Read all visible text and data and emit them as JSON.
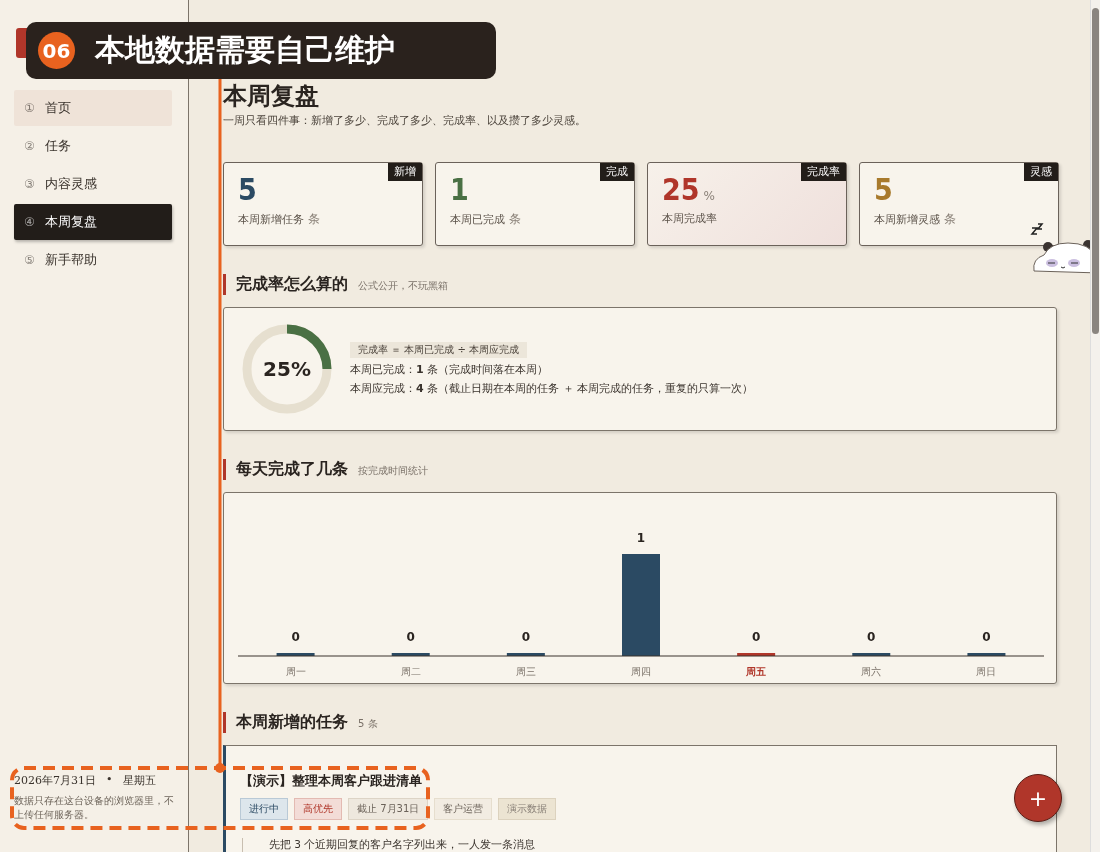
{
  "callout": {
    "badge": "06",
    "text": "本地数据需要自己维护"
  },
  "sidebar": {
    "items": [
      {
        "index": "①",
        "label": "首页",
        "selected": false,
        "hovered": true
      },
      {
        "index": "②",
        "label": "任务",
        "selected": false,
        "hovered": false
      },
      {
        "index": "③",
        "label": "内容灵感",
        "selected": false,
        "hovered": false
      },
      {
        "index": "④",
        "label": "本周复盘",
        "selected": true,
        "hovered": false
      },
      {
        "index": "⑤",
        "label": "新手帮助",
        "selected": false,
        "hovered": false
      }
    ],
    "date": "2026年7月31日",
    "separator": "•",
    "weekday": "星期五",
    "note": "数据只存在这台设备的浏览器里，不上传任何服务器。"
  },
  "page": {
    "title": "本周复盘",
    "subtitle": "一周只看四件事：新增了多少、完成了多少、完成率、以及攒了多少灵感。"
  },
  "stats": [
    {
      "tag": "新增",
      "value": "5",
      "unit": "条",
      "kind": "count",
      "label": "本周新增任务",
      "color": "#2b4a63",
      "tinted": false,
      "mascot": false
    },
    {
      "tag": "完成",
      "value": "1",
      "unit": "条",
      "kind": "count",
      "label": "本周已完成",
      "color": "#4a7044",
      "tinted": false,
      "mascot": false
    },
    {
      "tag": "完成率",
      "value": "25",
      "unit": "%",
      "kind": "percent",
      "label": "本周完成率",
      "color": "#b0362a",
      "tinted": true,
      "mascot": false
    },
    {
      "tag": "灵感",
      "value": "5",
      "unit": "条",
      "kind": "count",
      "label": "本周新增灵感",
      "color": "#a87a2c",
      "tinted": false,
      "mascot": true
    }
  ],
  "rate_section": {
    "title": "完成率怎么算的",
    "subtitle": "公式公开，不玩黑箱",
    "donut": {
      "level": 0.25,
      "reading": "25%"
    },
    "formula": "完成率 ＝ 本周已完成 ÷ 本周应完成",
    "lines": [
      "本周已完成：**1** 条（完成时间落在本周）",
      "本周应完成：**4** 条（截止日期在本周的任务 ＋ 本周完成的任务，重复的只算一次）"
    ]
  },
  "daily_section": {
    "title": "每天完成了几条",
    "subtitle": "按完成时间统计",
    "highlighted": [
      false,
      false,
      false,
      false,
      true,
      false,
      false
    ],
    "chart_data": {
      "type": "bar",
      "categories": [
        "周一",
        "周二",
        "周三",
        "周四",
        "周五",
        "周六",
        "周日"
      ],
      "values": [
        0,
        0,
        0,
        1,
        0,
        0,
        0
      ],
      "ylim": [
        0,
        1
      ],
      "data_labels": true
    }
  },
  "new_tasks": {
    "title": "本周新增的任务",
    "count": "5 条",
    "tasks": [
      {
        "title": "【演示】整理本周客户跟进清单",
        "tags": [
          {
            "kind": "status",
            "text": "进行中"
          },
          {
            "kind": "priority",
            "text": "高优先"
          },
          {
            "kind": "due",
            "text": "截止 7月31日"
          },
          {
            "kind": "plain",
            "text": "客户运营"
          },
          {
            "kind": "demo",
            "text": "演示数据"
          }
        ],
        "step": "先把 3 个近期回复的客户名字列出来，一人发一条消息"
      }
    ]
  },
  "fab": {
    "label": "+"
  }
}
